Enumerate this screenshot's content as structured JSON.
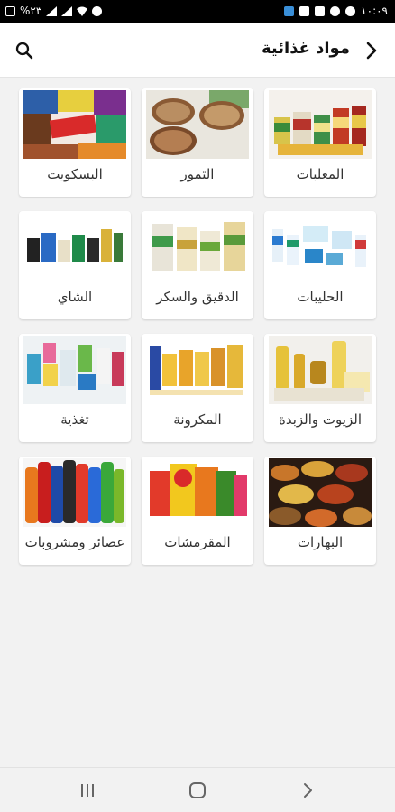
{
  "status_bar": {
    "battery": "%٢٣",
    "time": "١٠:٠٩",
    "left_icons": [
      "battery-icon",
      "signal-icon",
      "signal-icon",
      "wifi-icon",
      "alarm-icon"
    ],
    "right_icons": [
      "app-notification-icon",
      "gallery-icon",
      "file-icon",
      "person-icon",
      "settings-icon"
    ]
  },
  "header": {
    "title": "مواد غذائية",
    "back_icon": "chevron-right-icon",
    "search_icon": "search-icon"
  },
  "categories": [
    {
      "label": "المعلبات",
      "image": "canned-goods"
    },
    {
      "label": "التمور",
      "image": "dates"
    },
    {
      "label": "البسكويت",
      "image": "biscuits"
    },
    {
      "label": "الحليبات",
      "image": "dairy"
    },
    {
      "label": "الدقيق والسكر",
      "image": "flour-sugar"
    },
    {
      "label": "الشاي",
      "image": "tea"
    },
    {
      "label": "الزيوت والزبدة",
      "image": "oils-butter"
    },
    {
      "label": "المكرونة",
      "image": "pasta"
    },
    {
      "label": "تغذية",
      "image": "baby-nutrition"
    },
    {
      "label": "البهارات",
      "image": "spices"
    },
    {
      "label": "المقرمشات",
      "image": "chips"
    },
    {
      "label": "عصائر ومشروبات",
      "image": "juices-drinks"
    }
  ],
  "nav_bar": {
    "recents_icon": "recents-icon",
    "home_icon": "home-icon",
    "back_icon": "back-icon"
  },
  "colors": {
    "header_bg": "#ffffff",
    "page_bg": "#f2f2f2",
    "status_bar_bg": "#000000",
    "text": "#333333"
  }
}
